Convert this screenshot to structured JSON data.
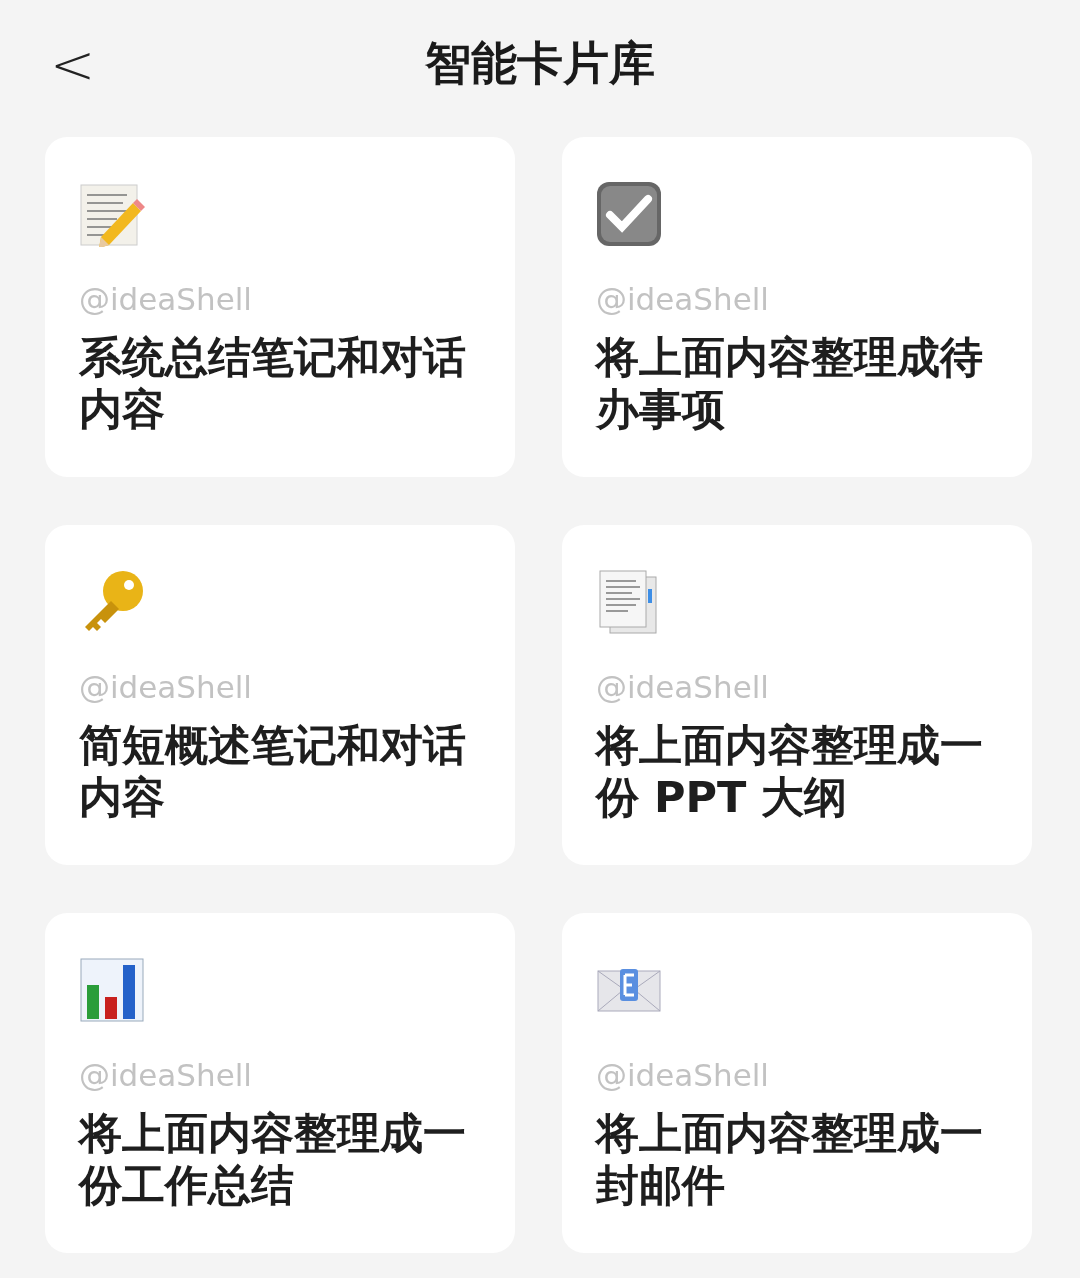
{
  "header": {
    "back": "<",
    "title": "智能卡片库"
  },
  "cards": [
    {
      "author": "@ideaShell",
      "title": "系统总结笔记和对话内容"
    },
    {
      "author": "@ideaShell",
      "title": "将上面内容整理成待办事项"
    },
    {
      "author": "@ideaShell",
      "title": "简短概述笔记和对话内容"
    },
    {
      "author": "@ideaShell",
      "title": "将上面内容整理成一份 PPT 大纲"
    },
    {
      "author": "@ideaShell",
      "title": "将上面内容整理成一份工作总结"
    },
    {
      "author": "@ideaShell",
      "title": "将上面内容整理成一封邮件"
    }
  ]
}
